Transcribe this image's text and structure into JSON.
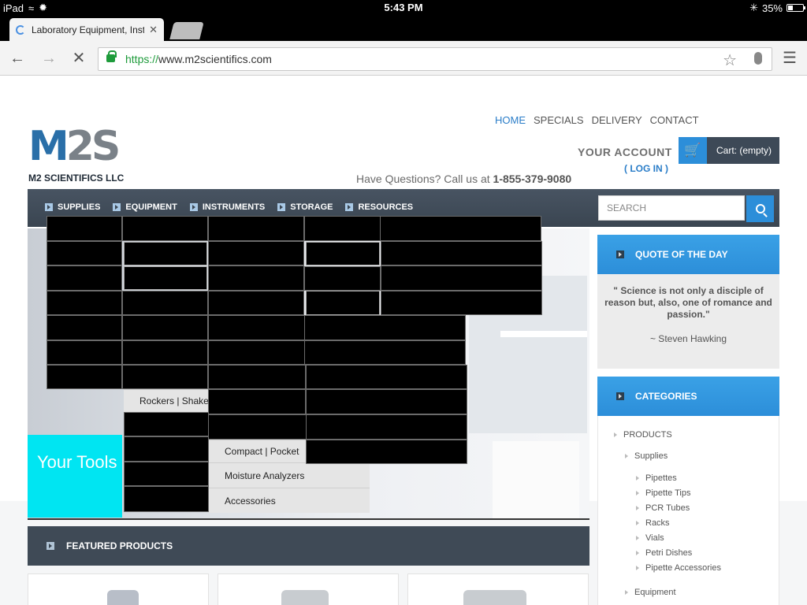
{
  "status_bar": {
    "device": "iPad",
    "time": "5:43 PM",
    "battery": "35%",
    "battery_level": 0.35
  },
  "browser": {
    "tab_title": "Laboratory Equipment, Inst",
    "url_scheme": "https://",
    "url_host": "www.m2scientifics.com"
  },
  "site": {
    "top_nav": [
      "HOME",
      "SPECIALS",
      "DELIVERY",
      "CONTACT"
    ],
    "logo_mark": "M2S",
    "logo_name": "M2 SCIENTIFICS LLC",
    "account_title": "YOUR ACCOUNT",
    "login": "( LOG IN )",
    "cart": "Cart: (empty)",
    "questions_prefix": "Have Questions? Call us at",
    "phone": "1-855-379-9080",
    "main_nav": [
      "SUPPLIES",
      "EQUIPMENT",
      "INSTRUMENTS",
      "STORAGE",
      "RESOURCES"
    ],
    "search_placeholder": "SEARCH",
    "hero_text": "Your Tools",
    "dropdown_visible": {
      "rockers": "Rockers | Shake",
      "compact": "Compact | Pocket",
      "moisture": "Moisture Analyzers",
      "accessories": "Accessories"
    },
    "featured_title": "FEATURED PRODUCTS",
    "quote_title": "QUOTE OF THE DAY",
    "quote_text": "\" Science is not only a disciple of reason but, also, one of romance and passion.\"",
    "quote_author": "~ Steven Hawking",
    "categories_title": "CATEGORIES",
    "categories": {
      "root": "PRODUCTS",
      "supplies": "Supplies",
      "items": [
        "Pipettes",
        "Pipette Tips",
        "PCR Tubes",
        "Racks",
        "Vials",
        "Petri Dishes",
        "Pipette Accessories"
      ],
      "equipment": "Equipment"
    }
  }
}
